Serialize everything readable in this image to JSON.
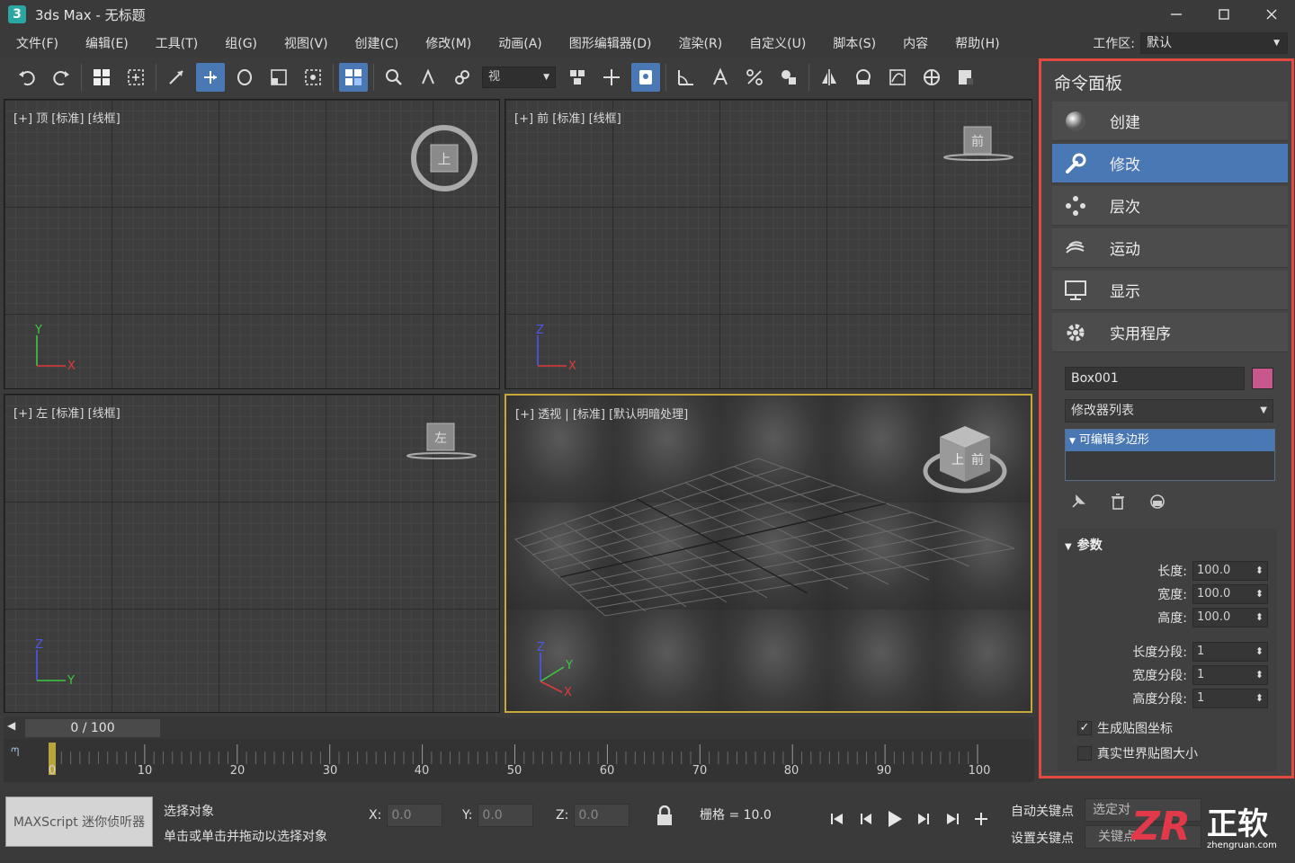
{
  "titlebar": {
    "title": "3ds Max - 无标题",
    "logo": "3"
  },
  "menubar": {
    "items": [
      "文件(F)",
      "编辑(E)",
      "工具(T)",
      "组(G)",
      "视图(V)",
      "创建(C)",
      "修改(M)",
      "动画(A)",
      "图形编辑器(D)",
      "渲染(R)",
      "自定义(U)",
      "脚本(S)",
      "内容",
      "帮助(H)"
    ],
    "workspace_label": "工作区:",
    "workspace_value": "默认"
  },
  "toolbar": {
    "selection_dropdown": "视"
  },
  "viewports": {
    "top": {
      "label": "[+]  顶  [标准] [线框]",
      "gizmo": "上"
    },
    "front": {
      "label": "[+]  前  [标准] [线框]",
      "gizmo": "前"
    },
    "left": {
      "label": "[+]  左  [标准] [线框]",
      "gizmo": "左"
    },
    "perspective": {
      "label": "[+]  透视  | [标准] [默认明暗处理]",
      "gizmo_top": "上",
      "gizmo_front": "前"
    }
  },
  "command_panel": {
    "title": "命令面板",
    "tabs": [
      "创建",
      "修改",
      "层次",
      "运动",
      "显示",
      "实用程序"
    ],
    "active_tab": "修改",
    "object_name": "Box001",
    "object_color": "#c8578d",
    "modifier_list": "修改器列表",
    "stack_item": "可编辑多边形",
    "rollout_title": "参数",
    "params": [
      {
        "label": "长度:",
        "value": "100.0"
      },
      {
        "label": "宽度:",
        "value": "100.0"
      },
      {
        "label": "高度:",
        "value": "100.0"
      },
      {
        "label": "长度分段:",
        "value": "1"
      },
      {
        "label": "宽度分段:",
        "value": "1"
      },
      {
        "label": "高度分段:",
        "value": "1"
      }
    ],
    "checkboxes": [
      {
        "label": "生成贴图坐标",
        "checked": true
      },
      {
        "label": "真实世界贴图大小",
        "checked": false
      }
    ]
  },
  "timeline": {
    "slider_text": "0 / 100",
    "ruler": [
      "0",
      "10",
      "20",
      "30",
      "40",
      "50",
      "60",
      "70",
      "80",
      "90",
      "100"
    ]
  },
  "statusbar": {
    "maxscript": "MAXScript 迷你侦听器",
    "line1": "选择对象",
    "line2": "单击或单击并拖动以选择对象",
    "x_label": "X:",
    "x_value": "0.0",
    "y_label": "Y:",
    "y_value": "0.0",
    "z_label": "Z:",
    "z_value": "0.0",
    "grid": "栅格 = 10.0",
    "auto_key": "自动关键点",
    "set_key": "设置关键点",
    "selected": "选定对",
    "key_filter": "关键点"
  },
  "watermark": {
    "brand": "正软",
    "logo": "ZR",
    "url": "zhengruan.com"
  },
  "colors": {
    "accent": "#4a78b5",
    "highlight_border": "#e2493f",
    "viewport_active": "#c9a83a"
  }
}
